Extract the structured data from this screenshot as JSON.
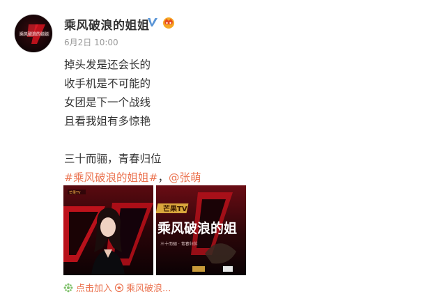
{
  "account": {
    "name": "乘风破浪的姐姐",
    "verified_icon": "verified-v-icon",
    "vip_icon": "vip-crown-icon",
    "avatar_text": "乘风破浪的姐姐",
    "colors": {
      "verified": "#5a95d6",
      "accent": "#eb7350"
    }
  },
  "post": {
    "time": "6月2日 10:00",
    "lines": [
      "掉头发是还会长的",
      "收手机是不可能的",
      "女团是下一个战线",
      "且看我姐有多惊艳",
      "",
      "三十而骊，青春归位"
    ],
    "hashtag": "#乘风破浪的姐姐#",
    "separator": "，",
    "mention": "@张萌"
  },
  "images": [
    {
      "name": "poster-zhang-meng",
      "logo_text": "芒果TV"
    },
    {
      "name": "poster-show-title",
      "title_text": "乘风破浪的姐",
      "badge_text": "芒果TV",
      "sub_text": "三十而骊 · 青春归位"
    }
  ],
  "supertopic": {
    "prefix_text": "点击加入",
    "topic_text": "乘风破浪...",
    "icon": "supertopic-icon"
  }
}
